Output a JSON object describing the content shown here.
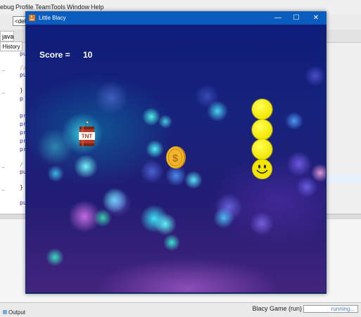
{
  "ide": {
    "menu": [
      "ebug",
      "Profile",
      "Team",
      "Tools",
      "Window",
      "Help"
    ],
    "config_combo": "<def",
    "file_tab": "java",
    "history_tab": "History",
    "code_snippets": [
      "pu",
      "//",
      "pu",
      "}",
      "p",
      "pr",
      "pr",
      "pr",
      "pr",
      "pr",
      "/",
      "pu",
      "}",
      "pu"
    ],
    "output_tab": "Output",
    "status_project": "Blacy Game (run)",
    "status_progress": "running..."
  },
  "game": {
    "window_title": "Little Blacy",
    "title_buttons": {
      "minimize": "—",
      "maximize": "☐",
      "close": "✕"
    },
    "score_label": "Score =",
    "score_value": "10",
    "snake_body_count": 3,
    "items": {
      "coin_symbol": "$",
      "tnt_label": "TNT"
    },
    "colors": {
      "titlebar": "#0a5cbf",
      "background_top": "#0e1d7a",
      "background_bottom": "#43247d",
      "snake": "#f2e600",
      "coin": "#f1b62c",
      "tnt": "#b93a22"
    }
  }
}
